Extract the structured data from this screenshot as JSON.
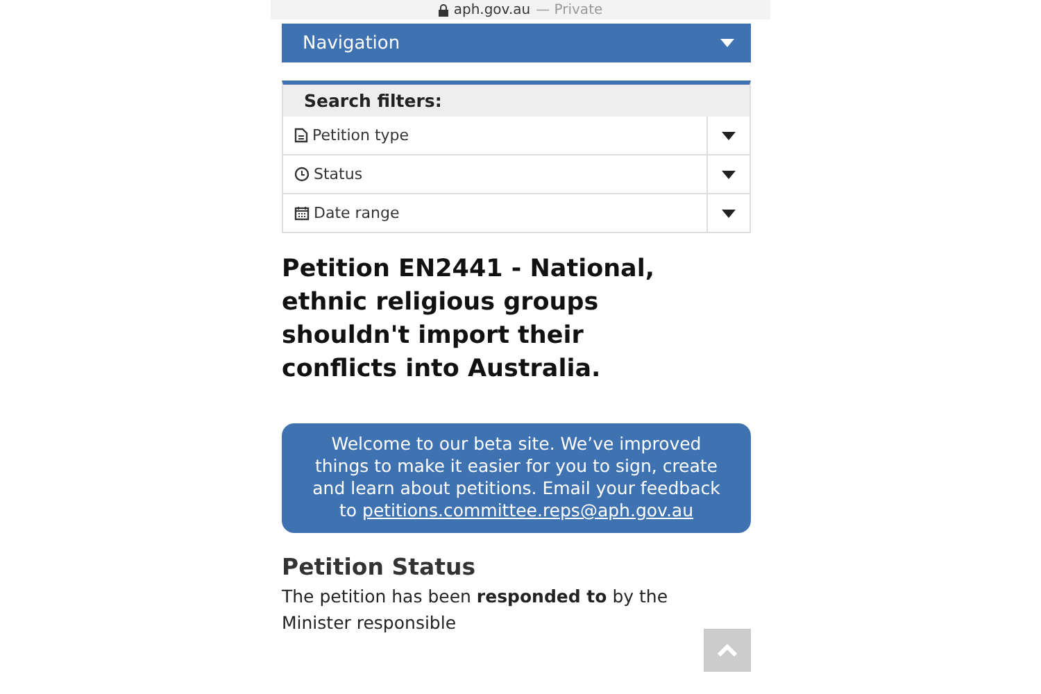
{
  "address_bar": {
    "domain": "aph.gov.au",
    "mode": "— Private"
  },
  "navigation": {
    "label": "Navigation"
  },
  "search_filters": {
    "title": "Search filters:",
    "filters": [
      {
        "kind": "document",
        "label": "Petition type"
      },
      {
        "kind": "clock",
        "label": "Status"
      },
      {
        "kind": "calendar",
        "label": "Date range"
      }
    ]
  },
  "title": "Petition EN2441 - National, ethnic religious groups shouldn't import their conflicts into Australia.",
  "notice": {
    "text": "Welcome to our beta site. We’ve improved things to make it easier for you to sign, create and learn about petitions. Email your feedback to",
    "link": "petitions.committee.reps@aph.gov.au"
  },
  "petition_status": {
    "heading": "Petition Status",
    "text": "The petition has been **responded to** by the Minister responsible"
  }
}
